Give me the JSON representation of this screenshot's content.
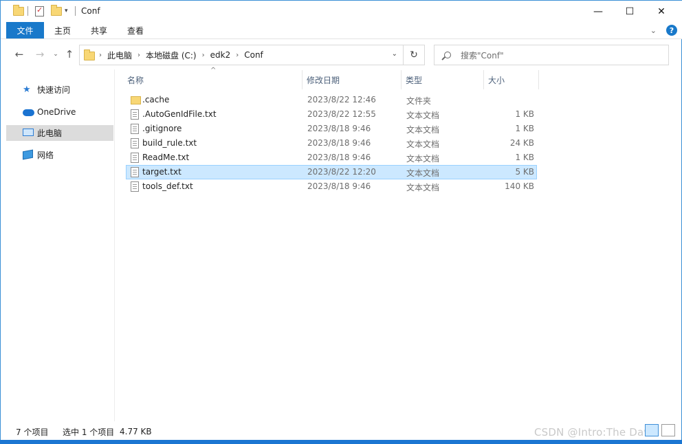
{
  "window": {
    "title": "Conf"
  },
  "ribbon": {
    "tabs": [
      "文件",
      "主页",
      "共享",
      "查看"
    ]
  },
  "address": {
    "crumbs": [
      "此电脑",
      "本地磁盘 (C:)",
      "edk2",
      "Conf"
    ]
  },
  "search": {
    "placeholder": "搜索\"Conf\""
  },
  "nav_pane": {
    "items": [
      {
        "label": "快速访问",
        "icon": "star-icon"
      },
      {
        "label": "OneDrive",
        "icon": "cloud-icon"
      },
      {
        "label": "此电脑",
        "icon": "computer-icon",
        "selected": true
      },
      {
        "label": "网络",
        "icon": "network-icon"
      }
    ]
  },
  "columns": {
    "name": "名称",
    "date": "修改日期",
    "type": "类型",
    "size": "大小"
  },
  "files": [
    {
      "name": ".cache",
      "date": "2023/8/22 12:46",
      "type": "文件夹",
      "size": "",
      "kind": "folder"
    },
    {
      "name": ".AutoGenIdFile.txt",
      "date": "2023/8/22 12:55",
      "type": "文本文档",
      "size": "1 KB",
      "kind": "file"
    },
    {
      "name": ".gitignore",
      "date": "2023/8/18 9:46",
      "type": "文本文档",
      "size": "1 KB",
      "kind": "file"
    },
    {
      "name": "build_rule.txt",
      "date": "2023/8/18 9:46",
      "type": "文本文档",
      "size": "24 KB",
      "kind": "file"
    },
    {
      "name": "ReadMe.txt",
      "date": "2023/8/18 9:46",
      "type": "文本文档",
      "size": "1 KB",
      "kind": "file"
    },
    {
      "name": "target.txt",
      "date": "2023/8/22 12:20",
      "type": "文本文档",
      "size": "5 KB",
      "kind": "file",
      "selected": true
    },
    {
      "name": "tools_def.txt",
      "date": "2023/8/18 9:46",
      "type": "文本文档",
      "size": "140 KB",
      "kind": "file"
    }
  ],
  "status": {
    "count": "7 个项目",
    "selection": "选中 1 个项目",
    "sel_size": "4.77 KB"
  },
  "watermark": "CSDN @Intro:The Dawn",
  "colors": {
    "accent": "#1979ca",
    "selection": "#cce8ff"
  }
}
